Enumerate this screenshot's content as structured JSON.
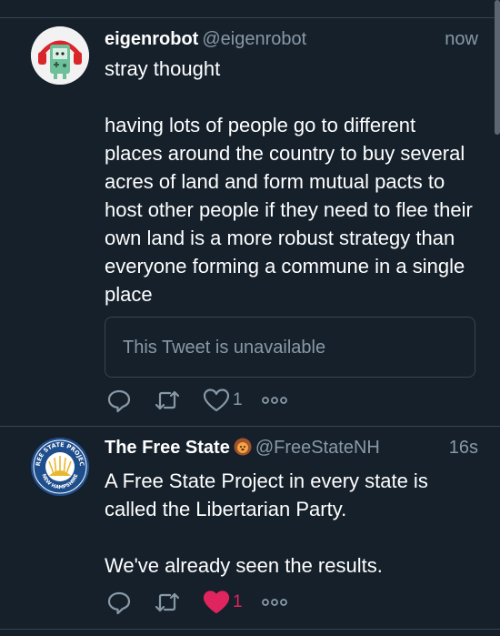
{
  "tweets": [
    {
      "name": "eigenrobot",
      "handle": "@eigenrobot",
      "time": "now",
      "text": "stray thought\n\nhaving lots of people go to different places around the country to buy several acres of land and form mutual pacts to host other people if they need to flee their own land is a more robust strategy than everyone forming a commune in a single place",
      "quote": "This Tweet is unavailable",
      "likes": "1",
      "liked": false
    },
    {
      "name": "The Free State",
      "handle": "@FreeStateNH",
      "time": "16s",
      "text": "A Free State Project in every state is called the Libertarian Party.\n\nWe've already seen the results.",
      "likes": "1",
      "liked": true,
      "avatar_text": {
        "top": "FREE STATE PROJECT",
        "bottom": "NEW HAMPSHIRE"
      }
    }
  ],
  "colors": {
    "background": "#15202b",
    "border": "#38444d",
    "secondary": "#8899a6",
    "like": "#e0245e",
    "text": "#ffffff"
  },
  "icons": [
    "reply-icon",
    "retweet-icon",
    "like-icon",
    "more-icon",
    "lion-emoji-icon"
  ]
}
